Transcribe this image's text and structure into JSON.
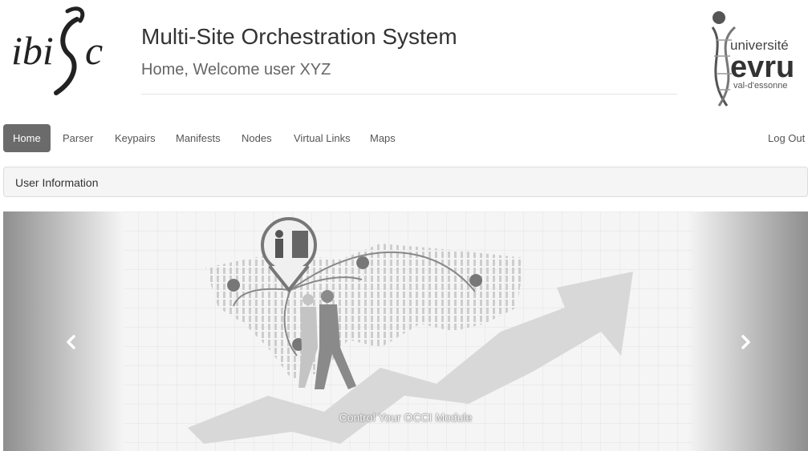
{
  "header": {
    "logo_left_text": "ibisc",
    "logo_right_text": "université evry val-d'essonne",
    "title": "Multi-Site Orchestration System",
    "subtitle": "Home, Welcome user XYZ"
  },
  "nav": {
    "items": [
      {
        "label": "Home",
        "active": true
      },
      {
        "label": "Parser",
        "active": false
      },
      {
        "label": "Keypairs",
        "active": false
      },
      {
        "label": "Manifests",
        "active": false
      },
      {
        "label": "Nodes",
        "active": false
      },
      {
        "label": "Virtual Links",
        "active": false
      },
      {
        "label": "Maps",
        "active": false
      }
    ],
    "logout_label": "Log Out"
  },
  "panel": {
    "title": "User Information"
  },
  "carousel": {
    "caption": "Control Your OCCI Module",
    "prev_icon": "chevron-left-icon",
    "next_icon": "chevron-right-icon"
  },
  "colors": {
    "nav_active_bg": "#6b6b6b",
    "panel_bg": "#f5f5f5"
  }
}
